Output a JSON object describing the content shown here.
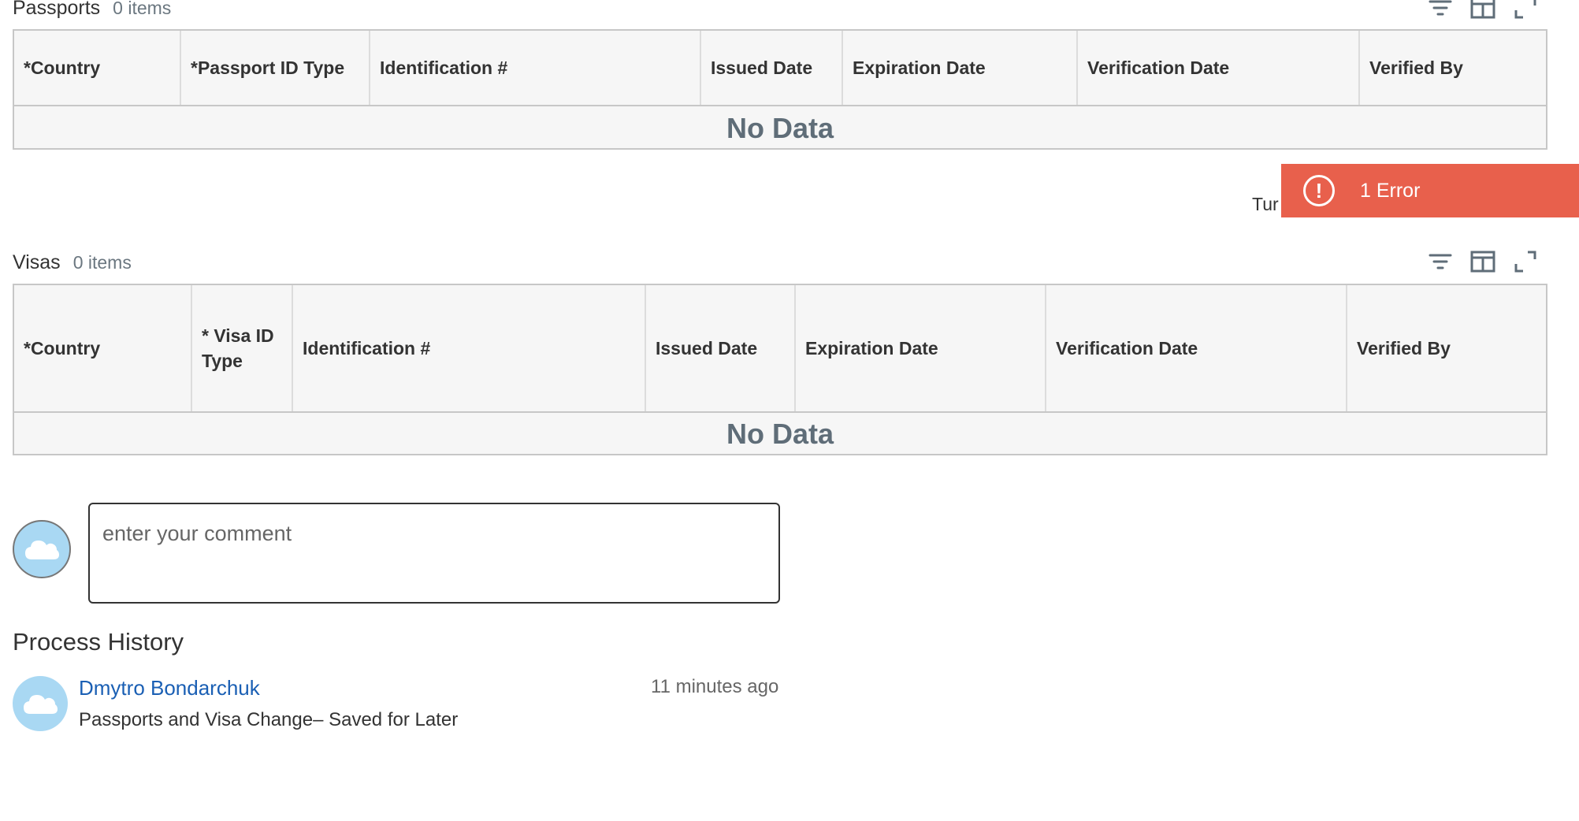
{
  "passports": {
    "title": "Passports",
    "count": "0 items",
    "columns": [
      "*Country",
      "*Passport ID Type",
      "Identification #",
      "Issued Date",
      "Expiration Date",
      "Verification Date",
      "Verified By"
    ],
    "no_data": "No Data"
  },
  "visas": {
    "title": "Visas",
    "count": "0 items",
    "columns": [
      "*Country",
      "* Visa ID Type",
      "Identification #",
      "Issued Date",
      "Expiration Date",
      "Verification Date",
      "Verified By"
    ],
    "no_data": "No Data"
  },
  "error_toast": {
    "label": "1 Error",
    "icon": "error-exclamation-icon",
    "color": "#e8604c"
  },
  "partial_text": "Tur",
  "comment": {
    "placeholder": "enter your comment",
    "avatar_icon": "cloud-icon"
  },
  "process_history": {
    "title": "Process History",
    "entries": [
      {
        "user": "Dmytro Bondarchuk",
        "time": "11 minutes ago",
        "description": "Passports and Visa Change– Saved for Later",
        "avatar_icon": "cloud-icon"
      }
    ]
  },
  "colors": {
    "accent": "#1a5fb4",
    "error": "#e8604c",
    "avatar": "#a9d8f3"
  }
}
